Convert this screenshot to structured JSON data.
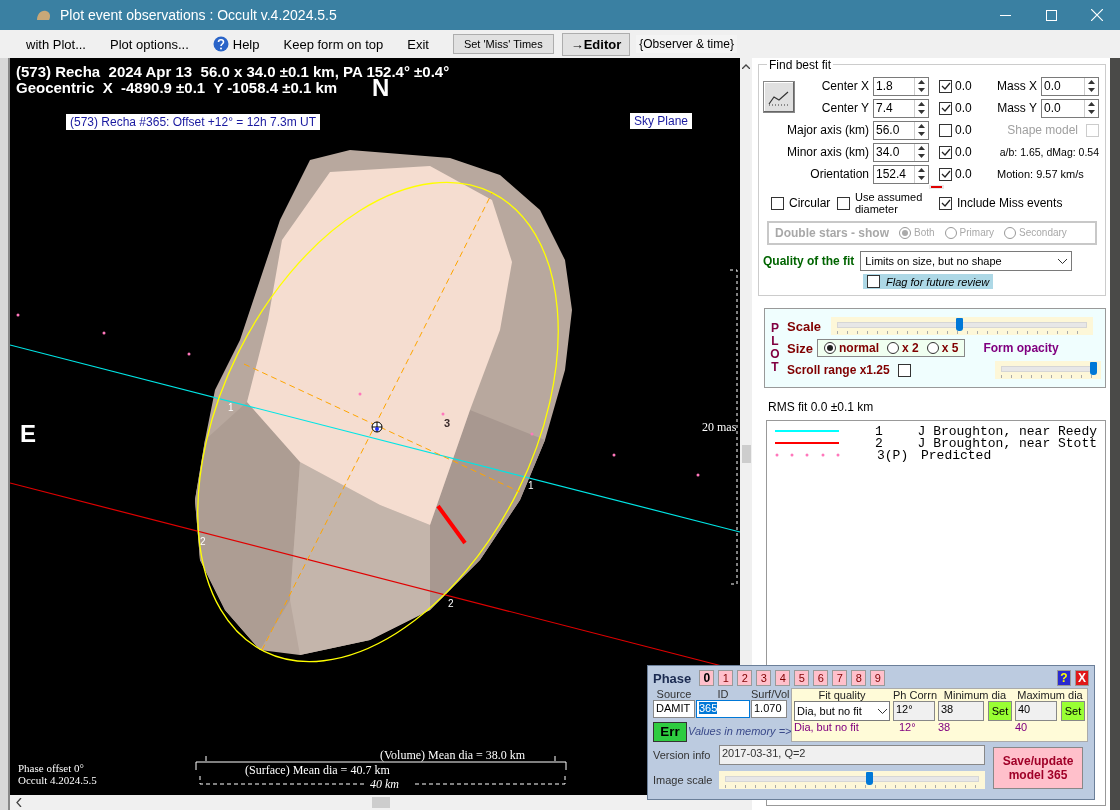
{
  "window": {
    "title": "Plot event observations : Occult v.4.2024.5.5"
  },
  "menu": [
    {
      "label": "with Plot...",
      "kind": "text"
    },
    {
      "label": "Plot options...",
      "kind": "text"
    },
    {
      "label": "Help",
      "kind": "help"
    },
    {
      "label": "Keep form on top",
      "kind": "text"
    },
    {
      "label": "Exit",
      "kind": "text"
    }
  ],
  "toolbar": {
    "miss_button": "Set 'Miss' Times",
    "editor_button": "→Editor",
    "observer_label": "{Observer & time}"
  },
  "plot": {
    "header": [
      "(573) Recha  2024 Apr 13  56.0 x 34.0 ±0.1 km, PA 152.4° ±0.4°",
      "Geocentric  X  -4890.9 ±0.1  Y -1058.4 ±0.1 km"
    ],
    "north": "N",
    "east": "E",
    "event_label": "(573) Recha #365: Offset +12° = 12h  7.3m UT",
    "view_label": "Sky Plane",
    "scale_label": "20 mas",
    "chords": [
      {
        "color": "#00e5e5",
        "end_labels": [
          "1",
          "1"
        ]
      },
      {
        "color": "#e00000",
        "end_labels": [
          "2",
          "2"
        ]
      }
    ],
    "predicted_label": "3",
    "phase_offset": "Phase offset 0°",
    "version": "Occult 4.2024.5.5",
    "volume_mean": "(Volume) Mean dia = 38.0 km",
    "surface_mean": "(Surface) Mean dia = 40.7 km",
    "scale_bar": "40 km"
  },
  "fit": {
    "title": "Find best fit",
    "params": [
      {
        "label": "Center X",
        "value": "1.8",
        "checked": true,
        "delta": "0.0"
      },
      {
        "label": "Center Y",
        "value": "7.4",
        "checked": true,
        "delta": "0.0"
      },
      {
        "label": "Major axis (km)",
        "value": "56.0",
        "checked": false,
        "delta": "0.0"
      },
      {
        "label": "Minor axis (km)",
        "value": "34.0",
        "checked": true,
        "delta": "0.0"
      },
      {
        "label": "Orientation",
        "value": "152.4",
        "checked": true,
        "delta": "0.0"
      }
    ],
    "mass": [
      {
        "label": "Mass X",
        "value": "0.0"
      },
      {
        "label": "Mass Y",
        "value": "0.0"
      }
    ],
    "shape_model": {
      "label": "Shape model",
      "checked": false,
      "disabled": true
    },
    "ratio_text": "a/b: 1.65, dMag: 0.54",
    "motion_text": "Motion: 9.57 km/s",
    "options": [
      {
        "label": "Circular",
        "checked": false
      },
      {
        "label": "Use assumed diameter",
        "checked": false
      },
      {
        "label": "Include Miss events",
        "checked": true
      }
    ],
    "double_stars": {
      "label": "Double stars - show",
      "disabled": true,
      "options": [
        {
          "label": "Both",
          "selected": true
        },
        {
          "label": "Primary",
          "selected": false
        },
        {
          "label": "Secondary",
          "selected": false
        }
      ]
    },
    "quality": {
      "label": "Quality of the fit",
      "value": "Limits on size, but no shape"
    },
    "flag": {
      "label": "Flag for future review",
      "checked": false
    }
  },
  "plot_panel": {
    "title": "PLOT",
    "scale": {
      "label": "Scale",
      "level": 0.49
    },
    "size": {
      "label": "Size",
      "options": [
        {
          "label": "normal",
          "selected": true
        },
        {
          "label": "x 2",
          "selected": false
        },
        {
          "label": "x 5",
          "selected": false
        }
      ]
    },
    "opacity": {
      "label": "Form opacity",
      "level": 1.0
    },
    "scroll_range": {
      "label": "Scroll range x1.25",
      "checked": false
    }
  },
  "rms": "RMS fit 0.0 ±0.1 km",
  "legend": [
    {
      "kind": "line",
      "color": "#00ffff",
      "number": "1",
      "name": "J Broughton, near Reedy"
    },
    {
      "kind": "line",
      "color": "#ff0000",
      "number": "2",
      "name": "J Broughton, near Stott"
    },
    {
      "kind": "dots",
      "color": "#ff77bb",
      "number": "3(P)",
      "name": "Predicted"
    }
  ],
  "phase_dialog": {
    "title": "Phase",
    "phases": [
      {
        "label": "0",
        "selected": true
      },
      {
        "label": "1",
        "selected": false
      },
      {
        "label": "2",
        "selected": false
      },
      {
        "label": "3",
        "selected": false
      },
      {
        "label": "4",
        "selected": false
      },
      {
        "label": "5",
        "selected": false
      },
      {
        "label": "6",
        "selected": false
      },
      {
        "label": "7",
        "selected": false
      },
      {
        "label": "8",
        "selected": false
      },
      {
        "label": "9",
        "selected": false
      }
    ],
    "help": "?",
    "close": "X",
    "source": {
      "label": "Source",
      "value": "DAMIT"
    },
    "id": {
      "label": "ID",
      "value": "365"
    },
    "surf_vol": {
      "label": "Surf/Vol",
      "value": "1.070"
    },
    "err_button": "Err",
    "memory_label": "Values in memory =>",
    "fit_quality": {
      "label": "Fit quality",
      "value": "Dia, but no fit",
      "memory": "Dia, but no fit"
    },
    "ph_corr": {
      "label": "Ph Corrn",
      "value": "12°",
      "memory": "12°"
    },
    "min_dia": {
      "label": "Minimum dia",
      "value": "38",
      "memory": "38",
      "button": "Set"
    },
    "max_dia": {
      "label": "Maximum dia",
      "value": "40",
      "memory": "40",
      "button": "Set"
    },
    "version": {
      "label": "Version info",
      "value": "2017-03-31, Q=2"
    },
    "image_scale": {
      "label": "Image scale",
      "level": 0.57
    },
    "save_button": "Save/update model 365"
  }
}
